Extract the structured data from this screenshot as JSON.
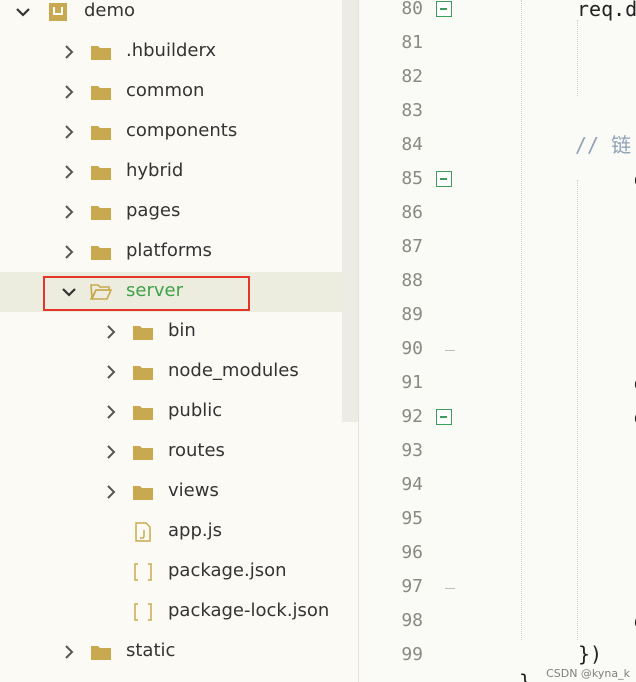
{
  "explorer": {
    "project": "demo",
    "items": [
      {
        "label": "demo",
        "type": "project",
        "depth": 0,
        "expanded": true
      },
      {
        "label": ".hbuilderx",
        "type": "folder",
        "depth": 1,
        "expanded": false
      },
      {
        "label": "common",
        "type": "folder",
        "depth": 1,
        "expanded": false
      },
      {
        "label": "components",
        "type": "folder",
        "depth": 1,
        "expanded": false
      },
      {
        "label": "hybrid",
        "type": "folder",
        "depth": 1,
        "expanded": false
      },
      {
        "label": "pages",
        "type": "folder",
        "depth": 1,
        "expanded": false
      },
      {
        "label": "platforms",
        "type": "folder",
        "depth": 1,
        "expanded": false
      },
      {
        "label": "server",
        "type": "folder",
        "depth": 1,
        "expanded": true,
        "selected": true
      },
      {
        "label": "bin",
        "type": "folder",
        "depth": 2,
        "expanded": false
      },
      {
        "label": "node_modules",
        "type": "folder",
        "depth": 2,
        "expanded": false
      },
      {
        "label": "public",
        "type": "folder",
        "depth": 2,
        "expanded": false
      },
      {
        "label": "routes",
        "type": "folder",
        "depth": 2,
        "expanded": false
      },
      {
        "label": "views",
        "type": "folder",
        "depth": 2,
        "expanded": false
      },
      {
        "label": "app.js",
        "type": "js-file",
        "depth": 2
      },
      {
        "label": "package.json",
        "type": "json-file",
        "depth": 2
      },
      {
        "label": "package-lock.json",
        "type": "json-file",
        "depth": 2
      },
      {
        "label": "static",
        "type": "folder",
        "depth": 1,
        "expanded": false
      }
    ]
  },
  "editor": {
    "line_numbers": [
      "80",
      "81",
      "82",
      "83",
      "84",
      "85",
      "86",
      "87",
      "88",
      "89",
      "90",
      "91",
      "92",
      "93",
      "94",
      "95",
      "96",
      "97",
      "98",
      "99"
    ],
    "fold_lines": [
      "80",
      "85",
      "92"
    ],
    "code": {
      "line80": "req.d",
      "line84": "// 链",
      "line99": "})",
      "partial_85": "c",
      "partial_91": "c",
      "partial_92": "c",
      "partial_98": "c"
    }
  },
  "watermark": "CSDN @kyna_k",
  "colors": {
    "selected_label": "#3fa14a",
    "folder": "#c9a94f",
    "highlight_border": "#e5352a",
    "fold_marker": "#3f9d5c"
  },
  "icons": {
    "project": "project-icon",
    "folder": "folder-icon",
    "open-folder": "folder-open-icon",
    "js-file": "js-file-icon",
    "json-file": "json-file-icon",
    "chevron-right": "chevron-right-icon",
    "chevron-down": "chevron-down-icon"
  }
}
